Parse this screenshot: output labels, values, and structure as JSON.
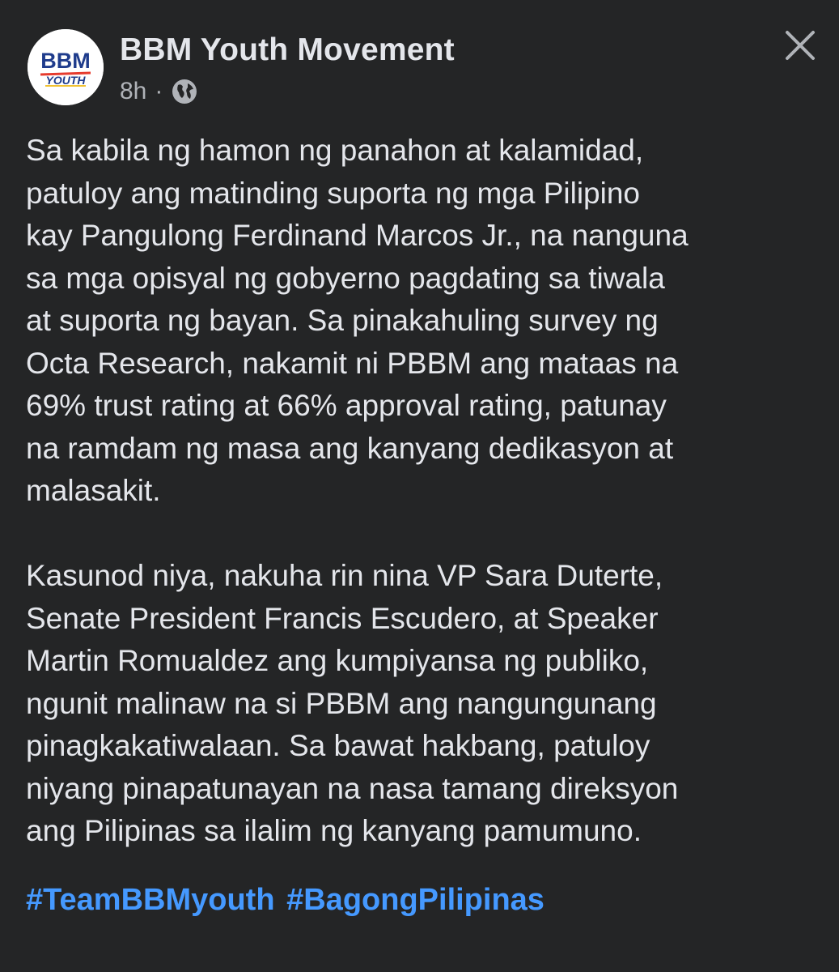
{
  "post": {
    "author": "BBM Youth Movement",
    "time": "8h",
    "separator": "·",
    "privacy_icon": "globe-icon",
    "close_icon": "close-icon",
    "avatar_logo": {
      "line1": "BBM",
      "line2": "YOUTH"
    },
    "paragraphs": [
      "Sa kabila ng hamon ng panahon at kalamidad,\npatuloy ang matinding suporta ng mga Pilipino\nkay Pangulong Ferdinand Marcos Jr., na nanguna\nsa mga opisyal ng gobyerno pagdating sa tiwala\nat suporta ng bayan. Sa pinakahuling survey ng\nOcta Research, nakamit ni PBBM ang mataas na\n69% trust rating at 66% approval rating, patunay\nna ramdam ng masa ang kanyang dedikasyon at\nmalasakit.",
      "Kasunod niya, nakuha rin nina VP Sara Duterte,\nSenate President Francis Escudero, at Speaker\nMartin Romualdez ang kumpiyansa ng publiko,\nngunit malinaw na si PBBM ang nangungunang\npinagkakatiwalaan. Sa bawat hakbang, patuloy\nniyang pinapatunayan na nasa tamang direksyon\nang Pilipinas sa ilalim ng kanyang pamumuno."
    ],
    "hashtags": [
      "#TeamBBMyouth",
      "#BagongPilipinas"
    ]
  },
  "colors": {
    "background": "#242526",
    "primary_text": "#e4e6eb",
    "secondary_text": "#b0b3b8",
    "hashtag": "#4599ff"
  }
}
